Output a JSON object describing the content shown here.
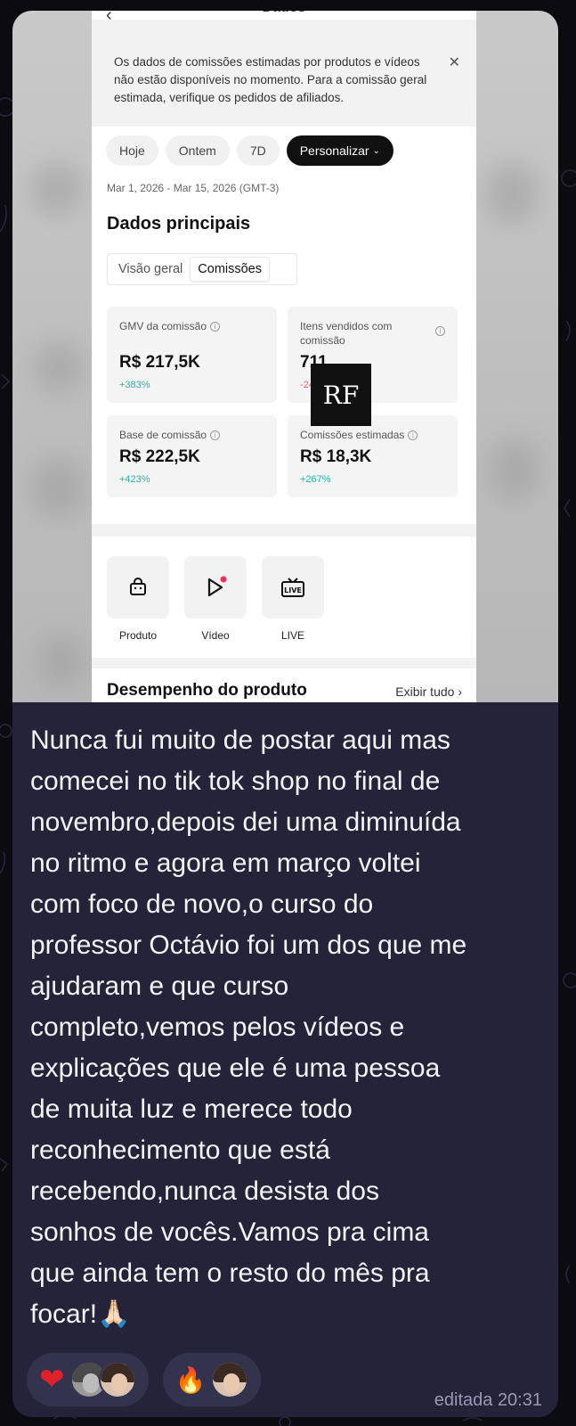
{
  "screenshot": {
    "screen_title": "Dados",
    "notice": {
      "text": "Os dados de comissões estimadas por produtos e vídeos não estão disponíveis no momento. Para a comissão geral estimada, verifique os pedidos de afiliados."
    },
    "date_filters": [
      {
        "label": "Hoje"
      },
      {
        "label": "Ontem"
      },
      {
        "label": "7D"
      },
      {
        "label": "Personalizar"
      }
    ],
    "date_range": "Mar 1, 2026 - Mar 15, 2026 (GMT-3)",
    "section_title": "Dados principais",
    "segments": {
      "overview": "Visão geral",
      "commissions": "Comissões"
    },
    "metrics": [
      {
        "label": "GMV da comissão",
        "value": "R$ 217,5K",
        "delta": "+383%"
      },
      {
        "label": "Itens vendidos com comissão",
        "value": "711",
        "delta": "-24.12%"
      },
      {
        "label": "Base de comissão",
        "value": "R$ 222,5K",
        "delta": "+423%"
      },
      {
        "label": "Comissões estimadas",
        "value": "R$ 18,3K",
        "delta": "+267%"
      }
    ],
    "watermark": "RF",
    "tools": [
      {
        "label": "Produto",
        "icon": "shopping-bag-icon"
      },
      {
        "label": "Vídeo",
        "icon": "play-icon"
      },
      {
        "label": "LIVE",
        "icon": "live-tv-icon",
        "icon_text": "LIVE"
      }
    ],
    "performance": {
      "title": "Desempenho do produto",
      "link": "Exibir tudo"
    }
  },
  "message": {
    "text": "Nunca fui muito de postar aqui mas\ncomecei no tik tok shop no final de\nnovembro,depois dei uma diminuída\nno ritmo e agora em março voltei\ncom foco de novo,o curso do\nprofessor Octávio foi um dos que me\najudaram e que curso\ncompleto,vemos pelos vídeos e\nexplicações que ele é uma pessoa\nde muita luz e merece todo\nreconhecimento que está\nrecebendo,nunca desista dos\nsonhos de vocês.Vamos pra cima\nque ainda tem o resto do mês pra\nfocar!",
    "trailing_emoji": "🙏🏻",
    "edited_label": "editada 20:31"
  },
  "reactions": [
    {
      "emoji": "❤",
      "icon": "heart-icon",
      "avatars": 2
    },
    {
      "emoji": "🔥",
      "icon": "fire-icon",
      "avatars": 1
    }
  ],
  "colors": {
    "bubble": "#24233a",
    "positive_delta": "#1fb3a8",
    "negative_delta": "#f05f5f",
    "live_dot": "#fe2c55"
  }
}
